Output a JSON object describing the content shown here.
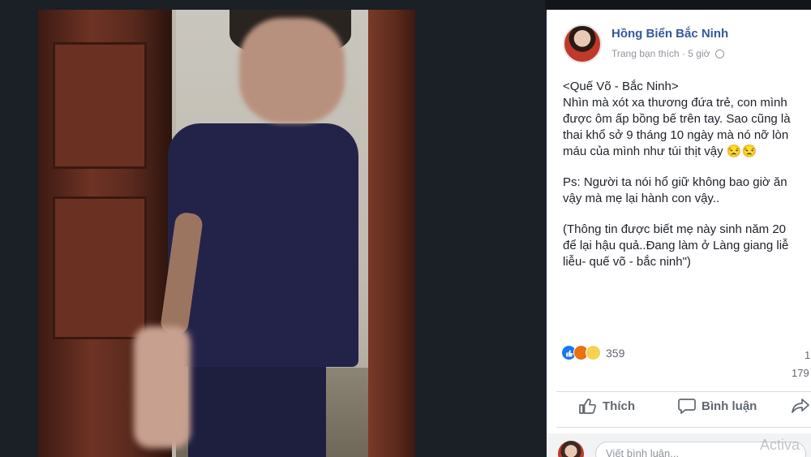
{
  "post": {
    "author": "Hồng Biển Bắc Ninh",
    "meta_source": "Trang bạn thích",
    "meta_separator": "·",
    "meta_time": "5 giờ",
    "body": [
      [
        "<Quế Võ - Bắc Ninh>",
        "Nhìn mà xót xa thương đứa trẻ, con mình",
        "được ôm ấp bồng bế trên tay. Sao cũng là",
        "thai khổ sở 9 tháng 10 ngày mà nó nỡ lòn",
        "máu của mình như túi thịt vậy 😒😒"
      ],
      [
        "Ps: Người ta nói hổ giữ không bao giờ ăn",
        "vậy mà mẹ lại hành con vậy.."
      ],
      [
        "(Thông tin được biết mẹ này sinh năm 20",
        "để lại hậu quả..Đang làm ở Làng giang liễ",
        "liễu- quế võ - bắc ninh\")"
      ]
    ],
    "reaction_count": "359",
    "comments_count": "1",
    "shares_count": "179",
    "actions": {
      "like": "Thích",
      "comment": "Bình luận"
    },
    "comment_placeholder": "Viết bình luận..."
  },
  "watermark": "Activa",
  "icons": {
    "like": "thumbs-up-icon",
    "comment": "speech-bubble-icon",
    "share": "share-arrow-icon",
    "privacy": "globe-icon"
  },
  "colors": {
    "author": "#365899",
    "background": "#1d2128",
    "like_reaction": "#1877f2"
  }
}
